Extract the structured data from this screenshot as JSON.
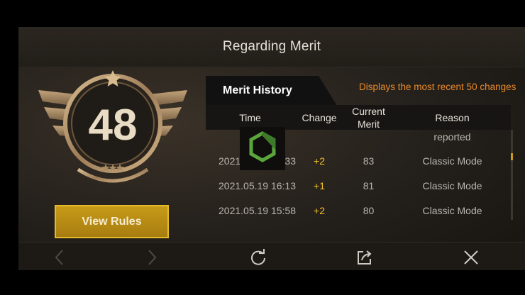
{
  "header": {
    "title": "Regarding Merit"
  },
  "badge": {
    "score": "48"
  },
  "buttons": {
    "view_rules": "View Rules"
  },
  "history": {
    "tab_label": "Merit History",
    "note": "Displays the most recent 50 changes",
    "columns": {
      "time": "Time",
      "change": "Change",
      "current_merit": "Current\nMerit",
      "reason": "Reason"
    },
    "partial_row": {
      "reason": "reported"
    },
    "rows": [
      {
        "time": "2021.05.19 16:33",
        "change": "+2",
        "merit": "83",
        "reason": "Classic Mode"
      },
      {
        "time": "2021.05.19 16:13",
        "change": "+1",
        "merit": "81",
        "reason": "Classic Mode"
      },
      {
        "time": "2021.05.19 15:58",
        "change": "+2",
        "merit": "80",
        "reason": "Classic Mode"
      }
    ]
  },
  "colors": {
    "accent_gold": "#c79a18",
    "note_orange": "#e98a2a",
    "change_yellow": "#f1c12c"
  },
  "icons": [
    "chevron-left-icon",
    "chevron-right-icon",
    "refresh-icon",
    "share-icon",
    "close-icon",
    "hexagon-loading-icon"
  ]
}
